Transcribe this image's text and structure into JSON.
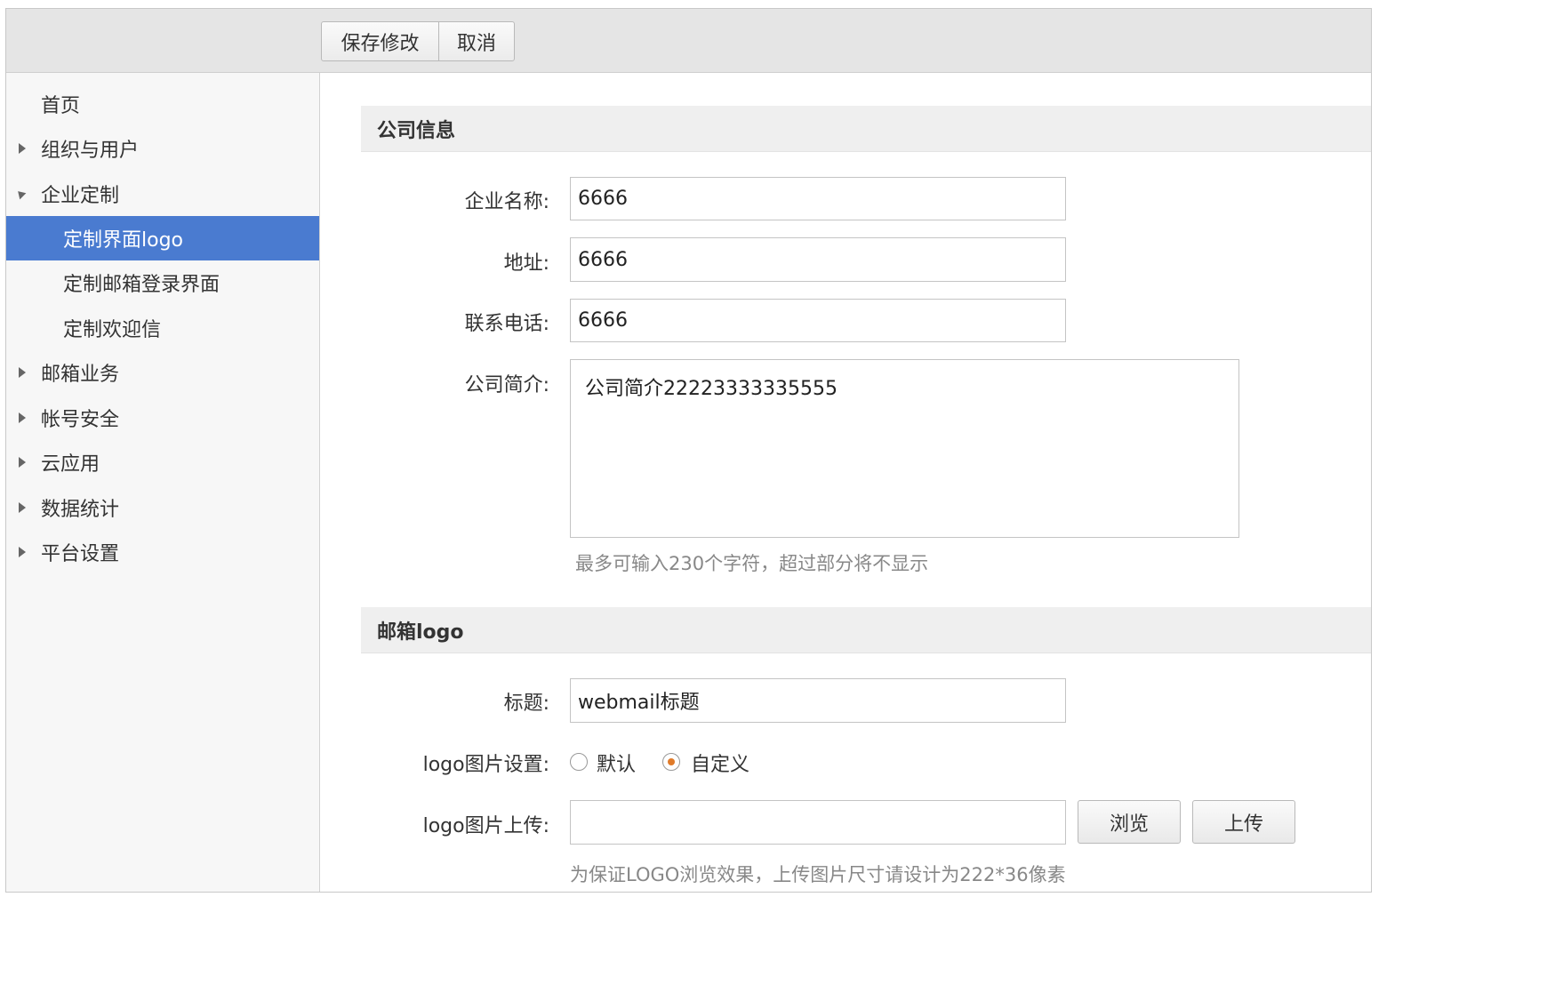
{
  "toolbar": {
    "save_label": "保存修改",
    "cancel_label": "取消"
  },
  "sidebar": {
    "items": [
      {
        "label": "首页"
      },
      {
        "label": "组织与用户"
      },
      {
        "label": "企业定制"
      },
      {
        "label": "定制界面logo"
      },
      {
        "label": "定制邮箱登录界面"
      },
      {
        "label": "定制欢迎信"
      },
      {
        "label": "邮箱业务"
      },
      {
        "label": "帐号安全"
      },
      {
        "label": "云应用"
      },
      {
        "label": "数据统计"
      },
      {
        "label": "平台设置"
      }
    ]
  },
  "company": {
    "heading": "公司信息",
    "name_label": "企业名称:",
    "name_value": "6666",
    "address_label": "地址:",
    "address_value": "6666",
    "phone_label": "联系电话:",
    "phone_value": "6666",
    "intro_label": "公司简介:",
    "intro_value": "公司简介22223333335555",
    "intro_hint": "最多可输入230个字符，超过部分将不显示"
  },
  "logo": {
    "heading": "邮箱logo",
    "title_label": "标题:",
    "title_value": "webmail标题",
    "image_setting_label": "logo图片设置:",
    "option_default": "默认",
    "option_custom": "自定义",
    "selected_option": "自定义",
    "upload_label": "logo图片上传:",
    "browse_label": "浏览",
    "upload_button_label": "上传",
    "upload_hint": "为保证LOGO浏览效果，上传图片尺寸请设计为222*36像素"
  },
  "colors": {
    "active_nav": "#4a7bd0",
    "radio_selected": "#e07b2a"
  }
}
